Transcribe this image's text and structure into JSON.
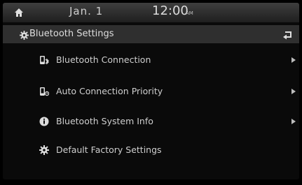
{
  "status": {
    "date": "Jan. 1",
    "time": "12:00",
    "ampm": "AM"
  },
  "header": {
    "title": "Bluetooth Settings"
  },
  "menu": {
    "items": [
      {
        "label": "Bluetooth Connection",
        "icon": "phone-bluetooth-icon",
        "has_submenu": true
      },
      {
        "label": "Auto Connection Priority",
        "icon": "auto-connect-icon",
        "has_submenu": true
      },
      {
        "label": "Bluetooth System Info",
        "icon": "info-icon",
        "has_submenu": true
      },
      {
        "label": "Default Factory Settings",
        "icon": "gear-icon",
        "has_submenu": false
      }
    ]
  },
  "colors": {
    "accent": "#ffffff",
    "text": "#cfcfcf",
    "background": "#0a0a0a"
  }
}
